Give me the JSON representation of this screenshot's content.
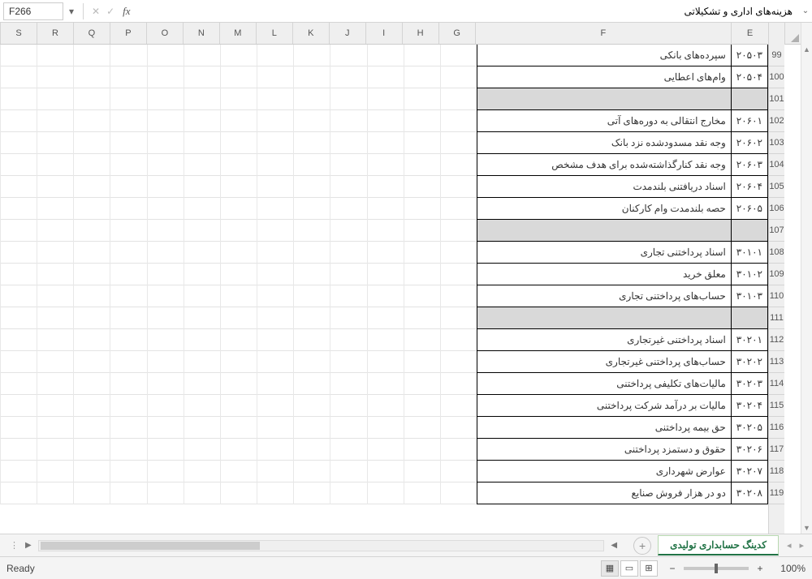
{
  "name_box": "F266",
  "formula_value": "هزینه‌های اداری و تشکیلاتی",
  "columns": [
    "E",
    "F",
    "G",
    "H",
    "I",
    "J",
    "K",
    "L",
    "M",
    "N",
    "O",
    "P",
    "Q",
    "R",
    "S"
  ],
  "rows": [
    {
      "num": 99,
      "e": "۲۰۵۰۳",
      "f": "سپرده‌های بانکی",
      "shaded": false
    },
    {
      "num": 100,
      "e": "۲۰۵۰۴",
      "f": "وام‌های اعطایی",
      "shaded": false
    },
    {
      "num": 101,
      "e": "",
      "f": "",
      "shaded": true
    },
    {
      "num": 102,
      "e": "۲۰۶۰۱",
      "f": "مخارج انتقالی به دوره‌های آتی",
      "shaded": false
    },
    {
      "num": 103,
      "e": "۲۰۶۰۲",
      "f": "وجه نقد مسدودشده نزد بانک",
      "shaded": false
    },
    {
      "num": 104,
      "e": "۲۰۶۰۳",
      "f": "وجه نقد کنارگذاشته‌شده برای هدف مشخص",
      "shaded": false
    },
    {
      "num": 105,
      "e": "۲۰۶۰۴",
      "f": "اسناد دریافتنی بلندمدت",
      "shaded": false
    },
    {
      "num": 106,
      "e": "۲۰۶۰۵",
      "f": "حصه بلندمدت وام کارکنان",
      "shaded": false
    },
    {
      "num": 107,
      "e": "",
      "f": "",
      "shaded": true
    },
    {
      "num": 108,
      "e": "۳۰۱۰۱",
      "f": "اسناد پرداختنی تجاری",
      "shaded": false
    },
    {
      "num": 109,
      "e": "۳۰۱۰۲",
      "f": "معلق خرید",
      "shaded": false
    },
    {
      "num": 110,
      "e": "۳۰۱۰۳",
      "f": "حساب‌های پرداختنی تجاری",
      "shaded": false
    },
    {
      "num": 111,
      "e": "",
      "f": "",
      "shaded": true
    },
    {
      "num": 112,
      "e": "۳۰۲۰۱",
      "f": "اسناد پرداختنی غیرتجاری",
      "shaded": false
    },
    {
      "num": 113,
      "e": "۳۰۲۰۲",
      "f": "حساب‌های پرداختنی غیرتجاری",
      "shaded": false
    },
    {
      "num": 114,
      "e": "۳۰۲۰۳",
      "f": "مالیات‌های تکلیفی پرداختنی",
      "shaded": false
    },
    {
      "num": 115,
      "e": "۳۰۲۰۴",
      "f": "مالیات بر درآمد شرکت پرداختنی",
      "shaded": false
    },
    {
      "num": 116,
      "e": "۳۰۲۰۵",
      "f": "حق بیمه پرداختنی",
      "shaded": false
    },
    {
      "num": 117,
      "e": "۳۰۲۰۶",
      "f": "حقوق و دستمزد پرداختنی",
      "shaded": false
    },
    {
      "num": 118,
      "e": "۳۰۲۰۷",
      "f": "عوارض شهرداری",
      "shaded": false
    },
    {
      "num": 119,
      "e": "۳۰۲۰۸",
      "f": "دو در هزار فروش صنایع",
      "shaded": false
    }
  ],
  "sheet_tab": "کدینگ حسابداری تولیدی",
  "status_text": "Ready",
  "zoom": "100%"
}
